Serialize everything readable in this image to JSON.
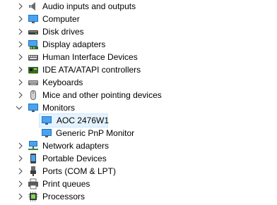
{
  "device_tree": {
    "items": [
      {
        "label": "Audio inputs and outputs",
        "icon": "speaker-icon",
        "expanded": false
      },
      {
        "label": "Computer",
        "icon": "monitor-icon",
        "expanded": false
      },
      {
        "label": "Disk drives",
        "icon": "disk-drive-icon",
        "expanded": false
      },
      {
        "label": "Display adapters",
        "icon": "display-adapter-icon",
        "expanded": false
      },
      {
        "label": "Human Interface Devices",
        "icon": "keyboard-hid-icon",
        "expanded": false
      },
      {
        "label": "IDE ATA/ATAPI controllers",
        "icon": "controller-icon",
        "expanded": false
      },
      {
        "label": "Keyboards",
        "icon": "keyboard-icon",
        "expanded": false
      },
      {
        "label": "Mice and other pointing devices",
        "icon": "mouse-icon",
        "expanded": false
      },
      {
        "label": "Monitors",
        "icon": "monitor-icon",
        "expanded": true,
        "children": [
          {
            "label": "AOC 2476W1",
            "icon": "monitor-icon",
            "selected": true
          },
          {
            "label": "Generic PnP Monitor",
            "icon": "monitor-icon",
            "selected": false
          }
        ]
      },
      {
        "label": "Network adapters",
        "icon": "network-adapter-icon",
        "expanded": false
      },
      {
        "label": "Portable Devices",
        "icon": "portable-device-icon",
        "expanded": false
      },
      {
        "label": "Ports (COM & LPT)",
        "icon": "port-icon",
        "expanded": false
      },
      {
        "label": "Print queues",
        "icon": "printer-icon",
        "expanded": false
      },
      {
        "label": "Processors",
        "icon": "processor-icon",
        "expanded": false
      }
    ]
  }
}
